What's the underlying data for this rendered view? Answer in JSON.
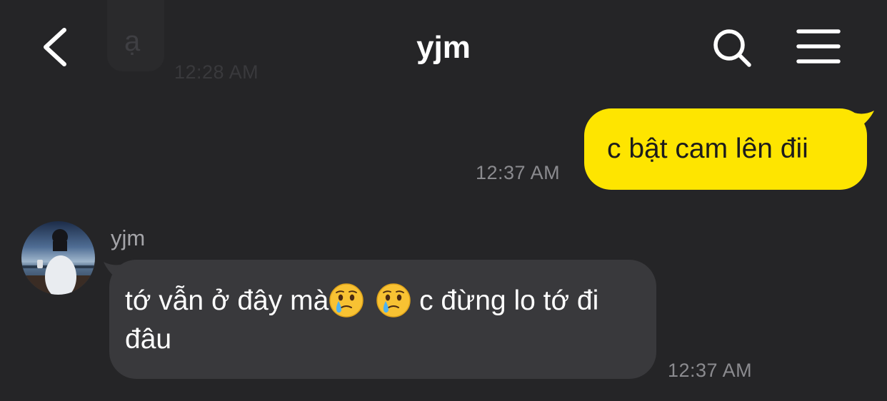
{
  "header": {
    "title": "yjm",
    "back_icon": "chevron-left-icon",
    "search_icon": "search-icon",
    "menu_icon": "hamburger-menu-icon"
  },
  "faded_message": {
    "text": "ạ",
    "time": "12:28 AM"
  },
  "messages": [
    {
      "direction": "outgoing",
      "text": "c bật cam lên đii",
      "time": "12:37 AM",
      "bubble_color": "#fee500"
    },
    {
      "direction": "incoming",
      "sender": "yjm",
      "text_before": "tớ vẫn ở đây mà",
      "emojis": [
        "face-holding-back-tears-icon",
        "face-holding-back-tears-icon"
      ],
      "text_after": " c đừng lo tớ đi đâu",
      "time": "12:37 AM",
      "bubble_color": "#39393c"
    }
  ],
  "colors": {
    "background": "#252527",
    "outgoing_bubble": "#fee500",
    "incoming_bubble": "#39393c",
    "timestamp": "#8b8b8f"
  }
}
